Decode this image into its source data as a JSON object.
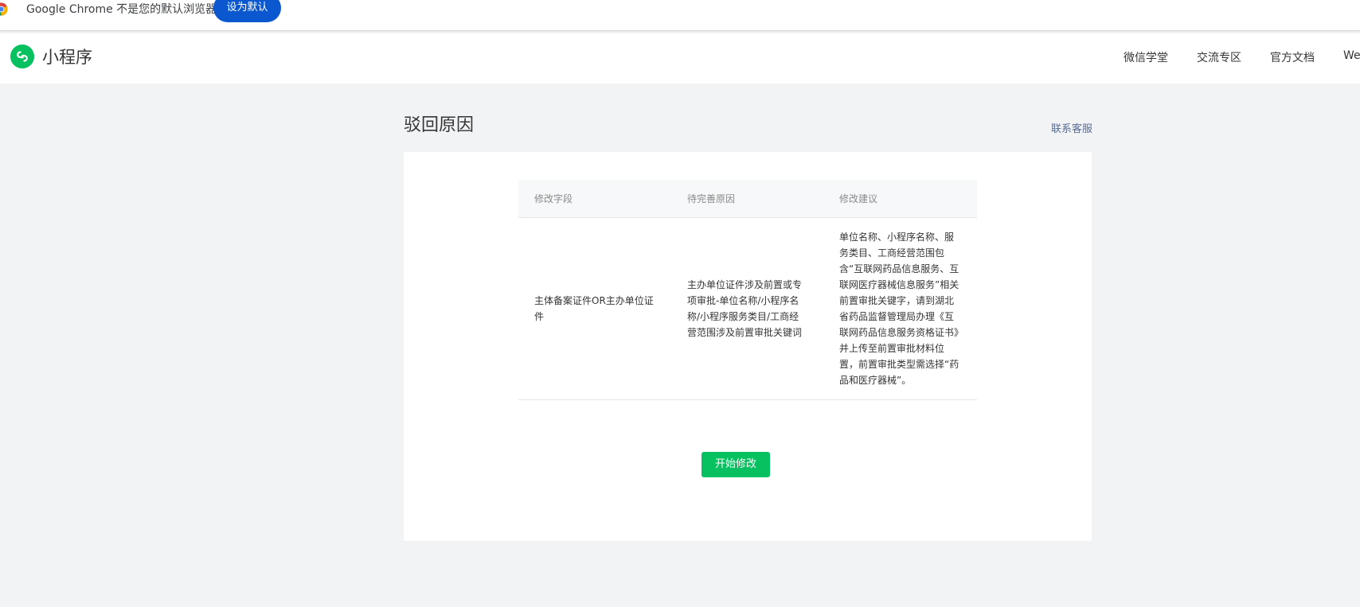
{
  "infobar": {
    "message": "Google Chrome 不是您的默认浏览器",
    "set_default_label": "设为默认"
  },
  "header": {
    "brand_name": "小程序",
    "nav": [
      "微信学堂",
      "交流专区",
      "官方文档",
      "We"
    ]
  },
  "page": {
    "title": "驳回原因",
    "contact_label": "联系客服",
    "table": {
      "headers": [
        "修改字段",
        "待完善原因",
        "修改建议"
      ],
      "rows": [
        {
          "field": "主体备案证件OR主办单位证件",
          "reason": "主办单位证件涉及前置或专项审批-单位名称/小程序名称/小程序服务类目/工商经营范围涉及前置审批关键词",
          "suggestion": "单位名称、小程序名称、服务类目、工商经营范围包含“互联网药品信息服务、互联网医疗器械信息服务”相关前置审批关键字，请到湖北省药品监督管理局办理《互联网药品信息服务资格证书》并上传至前置审批材料位置，前置审批类型需选择“药品和医疗器械”。"
        }
      ]
    },
    "start_button_label": "开始修改"
  },
  "colors": {
    "brand_green": "#07c160",
    "chrome_blue": "#0b57d0",
    "link_blue": "#576b95",
    "page_bg": "#f2f3f5"
  }
}
